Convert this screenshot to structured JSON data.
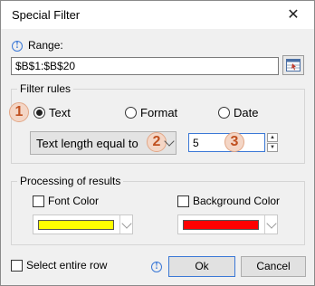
{
  "window": {
    "title": "Special Filter",
    "close_glyph": "✕"
  },
  "range": {
    "label": "Range:",
    "value": "$B$1:$B$20"
  },
  "filter_rules": {
    "legend": "Filter rules",
    "options": [
      {
        "label": "Text",
        "checked": true
      },
      {
        "label": "Format",
        "checked": false
      },
      {
        "label": "Date",
        "checked": false
      }
    ],
    "condition": "Text length equal to",
    "value": "5",
    "badges": [
      "1",
      "2",
      "3"
    ]
  },
  "processing": {
    "legend": "Processing of results",
    "font_color": {
      "label": "Font Color",
      "checked": false,
      "color": "#ffff00"
    },
    "background_color": {
      "label": "Background Color",
      "checked": false,
      "color": "#ff0000"
    }
  },
  "footer": {
    "select_entire_row": {
      "label": "Select entire row",
      "checked": false
    },
    "ok_label": "Ok",
    "cancel_label": "Cancel"
  },
  "icons": {
    "info": "info-icon",
    "range_picker": "range-picker-icon",
    "close": "close-icon",
    "chevron": "chevron-down-icon"
  }
}
